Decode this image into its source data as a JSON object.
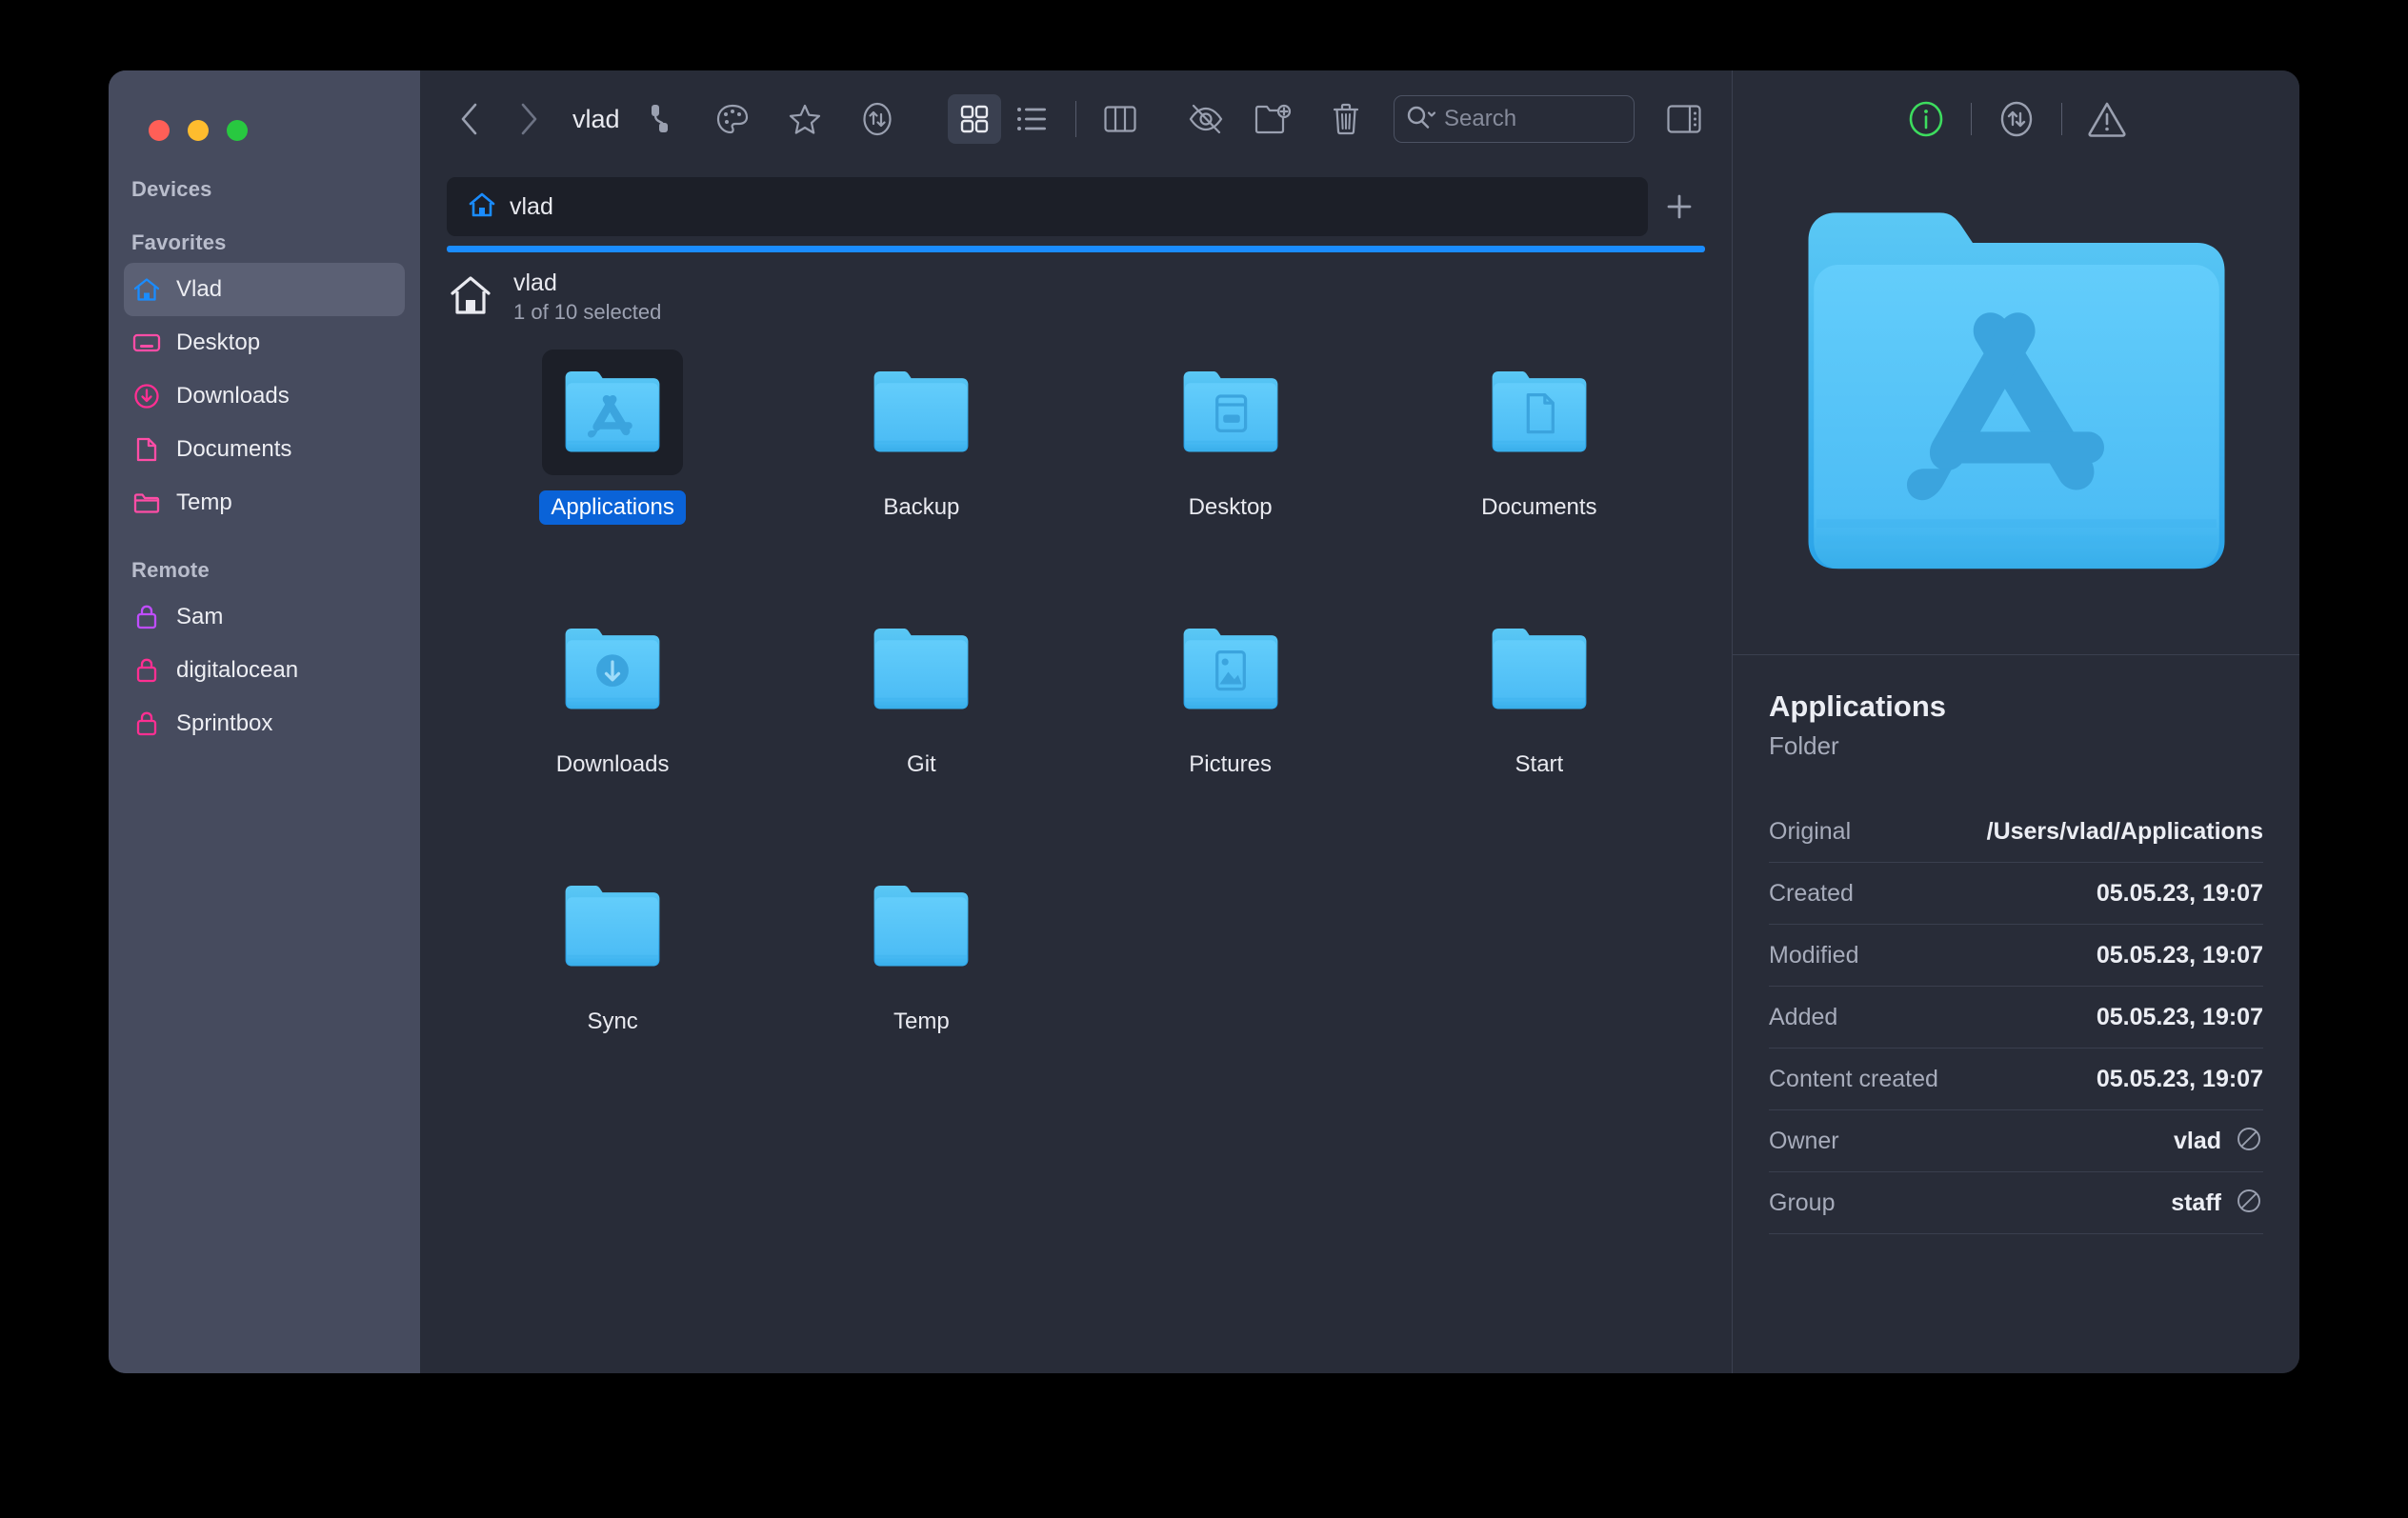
{
  "window": {
    "title": "vlad",
    "traffic_lights": [
      "close",
      "minimize",
      "zoom"
    ]
  },
  "sidebar": {
    "sections": [
      {
        "title": "Devices",
        "items": []
      },
      {
        "title": "Favorites",
        "items": [
          {
            "label": "Vlad",
            "icon": "home-icon",
            "color": "#1a8cff",
            "active": true
          },
          {
            "label": "Desktop",
            "icon": "desktop-icon",
            "color": "#ff4da6",
            "active": false
          },
          {
            "label": "Downloads",
            "icon": "download-circle-icon",
            "color": "#ff2f92",
            "active": false
          },
          {
            "label": "Documents",
            "icon": "document-icon",
            "color": "#ff4da6",
            "active": false
          },
          {
            "label": "Temp",
            "icon": "folder-icon",
            "color": "#ff4da6",
            "active": false
          }
        ]
      },
      {
        "title": "Remote",
        "items": [
          {
            "label": "Sam",
            "icon": "lock-icon",
            "color": "#c04dff",
            "active": false
          },
          {
            "label": "digitalocean",
            "icon": "lock-icon",
            "color": "#ff2f92",
            "active": false
          },
          {
            "label": "Sprintbox",
            "icon": "lock-icon",
            "color": "#ff2f92",
            "active": false
          }
        ]
      }
    ]
  },
  "toolbar": {
    "back": "back-icon",
    "forward": "forward-icon",
    "breadcrumb": "vlad",
    "actions": [
      {
        "name": "connection-icon",
        "label": "Connect"
      },
      {
        "name": "palette-icon",
        "label": "Tags"
      },
      {
        "name": "star-icon",
        "label": "Favorite"
      },
      {
        "name": "transfer-icon",
        "label": "Transfers"
      }
    ],
    "view_modes": [
      {
        "name": "grid-view-icon",
        "label": "Icon view",
        "selected": true
      },
      {
        "name": "list-view-icon",
        "label": "List view",
        "selected": false
      },
      {
        "name": "column-view-icon",
        "label": "Column view",
        "selected": false
      }
    ],
    "hidden_toggle": {
      "name": "eye-slash-icon",
      "label": "Show hidden files"
    },
    "new_folder": {
      "name": "new-folder-icon",
      "label": "New folder"
    },
    "trash": {
      "name": "trash-icon",
      "label": "Delete"
    },
    "panel_toggle": {
      "name": "sidebar-right-icon",
      "label": "Toggle info panel"
    }
  },
  "search": {
    "value": "",
    "placeholder": "Search",
    "icon": "search-icon",
    "chevron": "chevron-down-icon"
  },
  "tabs": {
    "items": [
      {
        "label": "vlad",
        "icon": "home-icon",
        "active": true
      }
    ],
    "add_label": "+",
    "accent_color": "#1a8cff"
  },
  "path_header": {
    "icon": "home-icon",
    "title": "vlad",
    "subtitle": "1 of 10 selected"
  },
  "files": [
    {
      "name": "Applications",
      "icon": "folder-appstore",
      "selected": true
    },
    {
      "name": "Backup",
      "icon": "folder-plain",
      "selected": false
    },
    {
      "name": "Desktop",
      "icon": "folder-desktop",
      "selected": false
    },
    {
      "name": "Documents",
      "icon": "folder-document",
      "selected": false
    },
    {
      "name": "Downloads",
      "icon": "folder-download",
      "selected": false
    },
    {
      "name": "Git",
      "icon": "folder-plain",
      "selected": false
    },
    {
      "name": "Pictures",
      "icon": "folder-picture",
      "selected": false
    },
    {
      "name": "Start",
      "icon": "folder-plain",
      "selected": false
    },
    {
      "name": "Sync",
      "icon": "folder-plain",
      "selected": false
    },
    {
      "name": "Temp",
      "icon": "folder-plain",
      "selected": false
    }
  ],
  "info_panel": {
    "toolbar": [
      {
        "name": "info-circle-icon",
        "label": "Info",
        "active": true,
        "color": "#3ddc5e"
      },
      {
        "name": "transfer-icon",
        "label": "Transfers",
        "active": false
      },
      {
        "name": "warning-triangle-icon",
        "label": "Warnings",
        "active": false
      }
    ],
    "preview_icon": "folder-appstore",
    "name": "Applications",
    "kind": "Folder",
    "meta": [
      {
        "key": "Original",
        "value": "/Users/vlad/Applications",
        "badge": null
      },
      {
        "key": "Created",
        "value": "05.05.23, 19:07",
        "badge": null
      },
      {
        "key": "Modified",
        "value": "05.05.23, 19:07",
        "badge": null
      },
      {
        "key": "Added",
        "value": "05.05.23, 19:07",
        "badge": null
      },
      {
        "key": "Content created",
        "value": "05.05.23, 19:07",
        "badge": null
      },
      {
        "key": "Owner",
        "value": "vlad",
        "badge": "no-entry-icon"
      },
      {
        "key": "Group",
        "value": "staff",
        "badge": "no-entry-icon"
      }
    ]
  },
  "colors": {
    "window_bg": "#282c38",
    "sidebar_bg": "#464b5e",
    "accent": "#1a8cff",
    "selection": "#0a63d8",
    "folder_blue": "#4cc2f7",
    "green": "#3ddc5e"
  }
}
